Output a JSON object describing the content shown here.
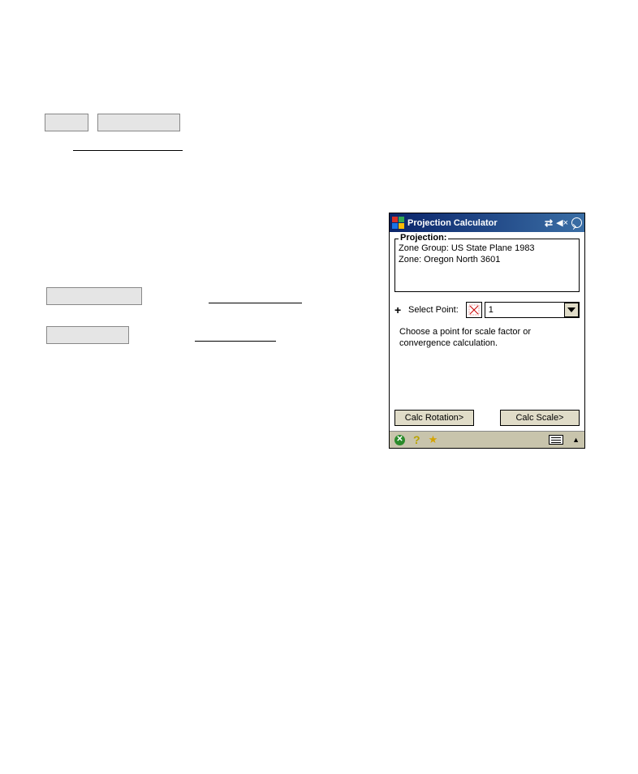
{
  "window": {
    "title": "Projection Calculator"
  },
  "projection": {
    "legend": "Projection:",
    "line1": "Zone Group: US State Plane 1983",
    "line2": "Zone: Oregon North 3601"
  },
  "selectPoint": {
    "label": "Select Point:",
    "value": "1"
  },
  "hint": "Choose a point for scale factor or convergence calculation.",
  "buttons": {
    "calcRotation": "Calc Rotation>",
    "calcScale": "Calc Scale>"
  }
}
